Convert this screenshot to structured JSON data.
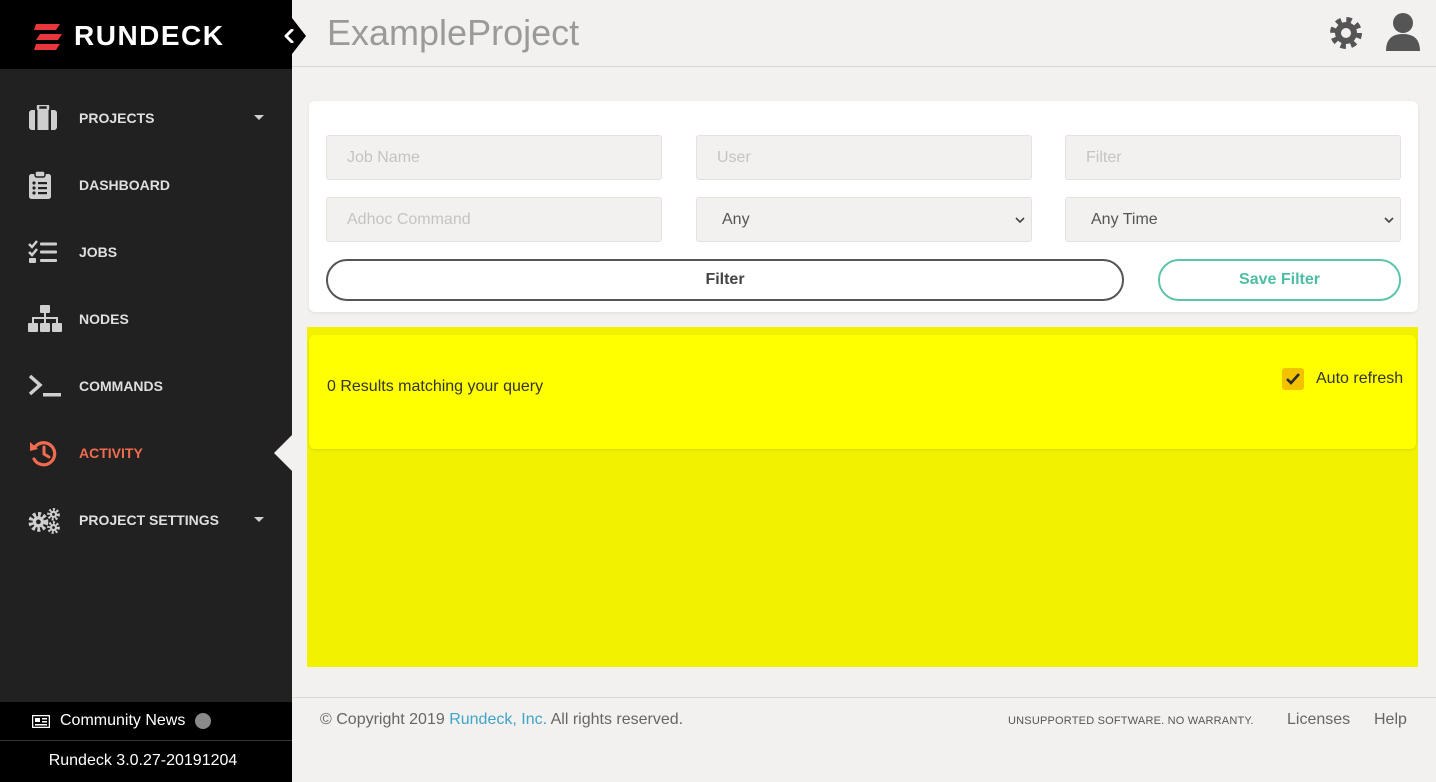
{
  "brand": {
    "name": "RUNDECK"
  },
  "sidebar": {
    "items": [
      {
        "label": "PROJECTS",
        "icon": "briefcase-icon",
        "has_dropdown": true
      },
      {
        "label": "DASHBOARD",
        "icon": "clipboard-icon"
      },
      {
        "label": "JOBS",
        "icon": "tasks-icon"
      },
      {
        "label": "NODES",
        "icon": "sitemap-icon"
      },
      {
        "label": "COMMANDS",
        "icon": "terminal-icon"
      },
      {
        "label": "ACTIVITY",
        "icon": "history-icon",
        "active": true
      },
      {
        "label": "PROJECT SETTINGS",
        "icon": "cogs-icon",
        "has_dropdown": true
      }
    ],
    "footer": {
      "news_label": "Community News",
      "version": "Rundeck 3.0.27-20191204"
    }
  },
  "header": {
    "title": "ExampleProject"
  },
  "filters": {
    "job_name_placeholder": "Job Name",
    "user_placeholder": "User",
    "filter_placeholder": "Filter",
    "adhoc_placeholder": "Adhoc Command",
    "status_value": "Any",
    "time_value": "Any Time",
    "filter_button": "Filter",
    "save_button": "Save Filter"
  },
  "results": {
    "summary": "0 Results matching your query",
    "auto_refresh_label": "Auto refresh",
    "auto_refresh_checked": true
  },
  "footer": {
    "copyright_prefix": "© Copyright 2019",
    "company_link": "Rundeck, Inc.",
    "copyright_suffix": "All rights reserved.",
    "warranty": "UNSUPPORTED SOFTWARE. NO WARRANTY.",
    "licenses": "Licenses",
    "help": "Help"
  },
  "colors": {
    "sidebar_bg": "#212121",
    "active": "#f36b4f",
    "accent_green": "#4dbea4",
    "highlight_yellow": "#ffff00",
    "link_blue": "#3ea4c8"
  }
}
